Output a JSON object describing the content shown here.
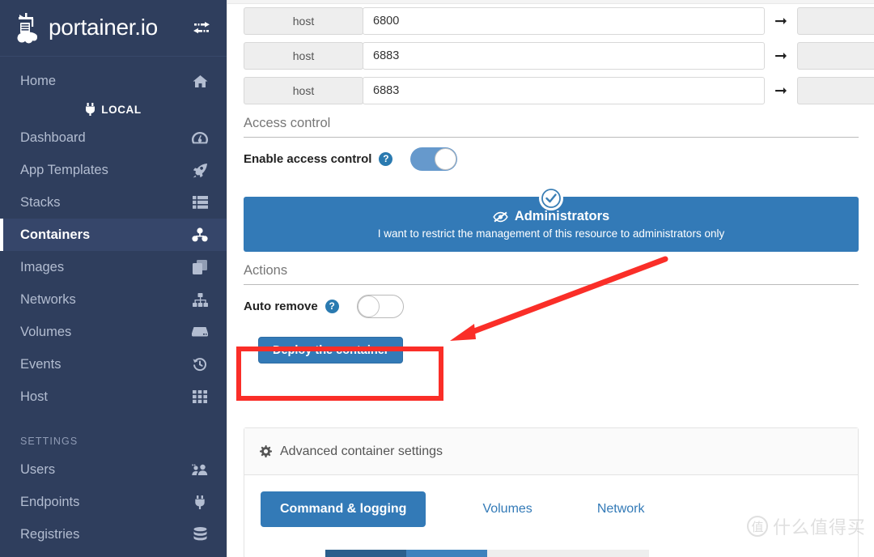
{
  "sidebar": {
    "brand": {
      "title": "portainer.io",
      "logo_icon": "portainer-whale-crane-logo",
      "toggle_icon": "exchange-arrows-icon"
    },
    "endpoint": {
      "label": "LOCAL",
      "icon": "plug-icon"
    },
    "items": [
      {
        "label": "Home",
        "icon": "home-icon",
        "active": false
      },
      {
        "label": "Dashboard",
        "icon": "dashboard-gauge-icon",
        "active": false
      },
      {
        "label": "App Templates",
        "icon": "rocket-icon",
        "active": false
      },
      {
        "label": "Stacks",
        "icon": "list-icon",
        "active": false
      },
      {
        "label": "Containers",
        "icon": "containers-icon",
        "active": true
      },
      {
        "label": "Images",
        "icon": "images-stack-icon",
        "active": false
      },
      {
        "label": "Networks",
        "icon": "sitemap-icon",
        "active": false
      },
      {
        "label": "Volumes",
        "icon": "hdd-icon",
        "active": false
      },
      {
        "label": "Events",
        "icon": "history-clock-icon",
        "active": false
      },
      {
        "label": "Host",
        "icon": "grid-th-icon",
        "active": false
      }
    ],
    "settings_section": {
      "title": "SETTINGS"
    },
    "settings_items": [
      {
        "label": "Users",
        "icon": "users-icon"
      },
      {
        "label": "Endpoints",
        "icon": "plug-icon"
      },
      {
        "label": "Registries",
        "icon": "database-icon"
      }
    ]
  },
  "ports": {
    "rows": [
      {
        "protocol": "host",
        "value": "6800",
        "arrow_icon": "arrow-right-icon"
      },
      {
        "protocol": "host",
        "value": "6883",
        "arrow_icon": "arrow-right-icon"
      },
      {
        "protocol": "host",
        "value": "6883",
        "arrow_icon": "arrow-right-icon"
      }
    ]
  },
  "access_control": {
    "heading": "Access control",
    "toggle_label": "Enable access control",
    "help_icon": "question-circle-icon",
    "toggle_state": "on",
    "panel": {
      "title": "Administrators",
      "title_icon": "eye-slash-icon",
      "subtitle": "I want to restrict the management of this resource to administrators only",
      "selected_icon": "check-circle-icon",
      "selected": true
    }
  },
  "actions": {
    "heading": "Actions",
    "auto_remove_label": "Auto remove",
    "auto_remove_help_icon": "question-circle-icon",
    "auto_remove_state": "off",
    "deploy_label": "Deploy the container"
  },
  "advanced": {
    "heading": "Advanced container settings",
    "heading_icon": "gear-icon",
    "tabs": [
      {
        "label": "Command & logging",
        "active": true
      },
      {
        "label": "Volumes",
        "active": false
      },
      {
        "label": "Network",
        "active": false
      }
    ]
  },
  "watermark": {
    "mark": "值",
    "text": "什么值得买"
  },
  "colors": {
    "sidebar_bg": "#2f3e5d",
    "sidebar_active_bg": "#36466a",
    "primary_blue": "#337ab7",
    "toggle_on": "#6699cc",
    "annotation_red": "#fa2e28"
  }
}
